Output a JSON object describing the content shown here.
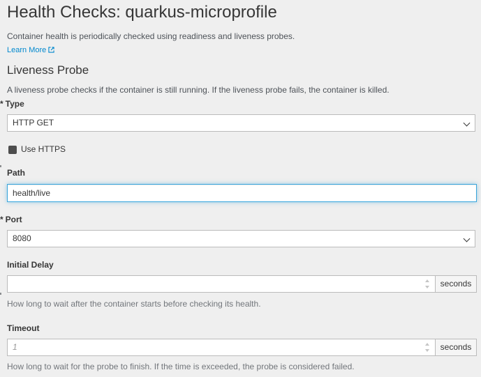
{
  "header": {
    "title": "Health Checks: quarkus-microprofile",
    "intro": "Container health is periodically checked using readiness and liveness probes.",
    "learn_more": "Learn More"
  },
  "probe": {
    "title": "Liveness Probe",
    "description": "A liveness probe checks if the container is still running. If the liveness probe fails, the container is killed."
  },
  "fields": {
    "type": {
      "required_mark": "*",
      "label": "Type",
      "value": "HTTP GET"
    },
    "use_https": {
      "label": "Use HTTPS",
      "checked": false
    },
    "path": {
      "label": "Path",
      "value": "health/live"
    },
    "port": {
      "required_mark": "*",
      "label": "Port",
      "value": "8080"
    },
    "initial_delay": {
      "label": "Initial Delay",
      "value": "",
      "unit": "seconds",
      "help": "How long to wait after the container starts before checking its health."
    },
    "timeout": {
      "label": "Timeout",
      "placeholder": "1",
      "unit": "seconds",
      "help": "How long to wait for the probe to finish. If the time is exceeded, the probe is considered failed."
    }
  },
  "colors": {
    "background": "#efefef",
    "link": "#0088ce",
    "focus_border": "#39a5dc",
    "checkbox": "#4d4d4d"
  },
  "icons": {
    "learn_more": "external-link-icon",
    "select": "chevron-down-icon",
    "number": "spinner-icon"
  }
}
